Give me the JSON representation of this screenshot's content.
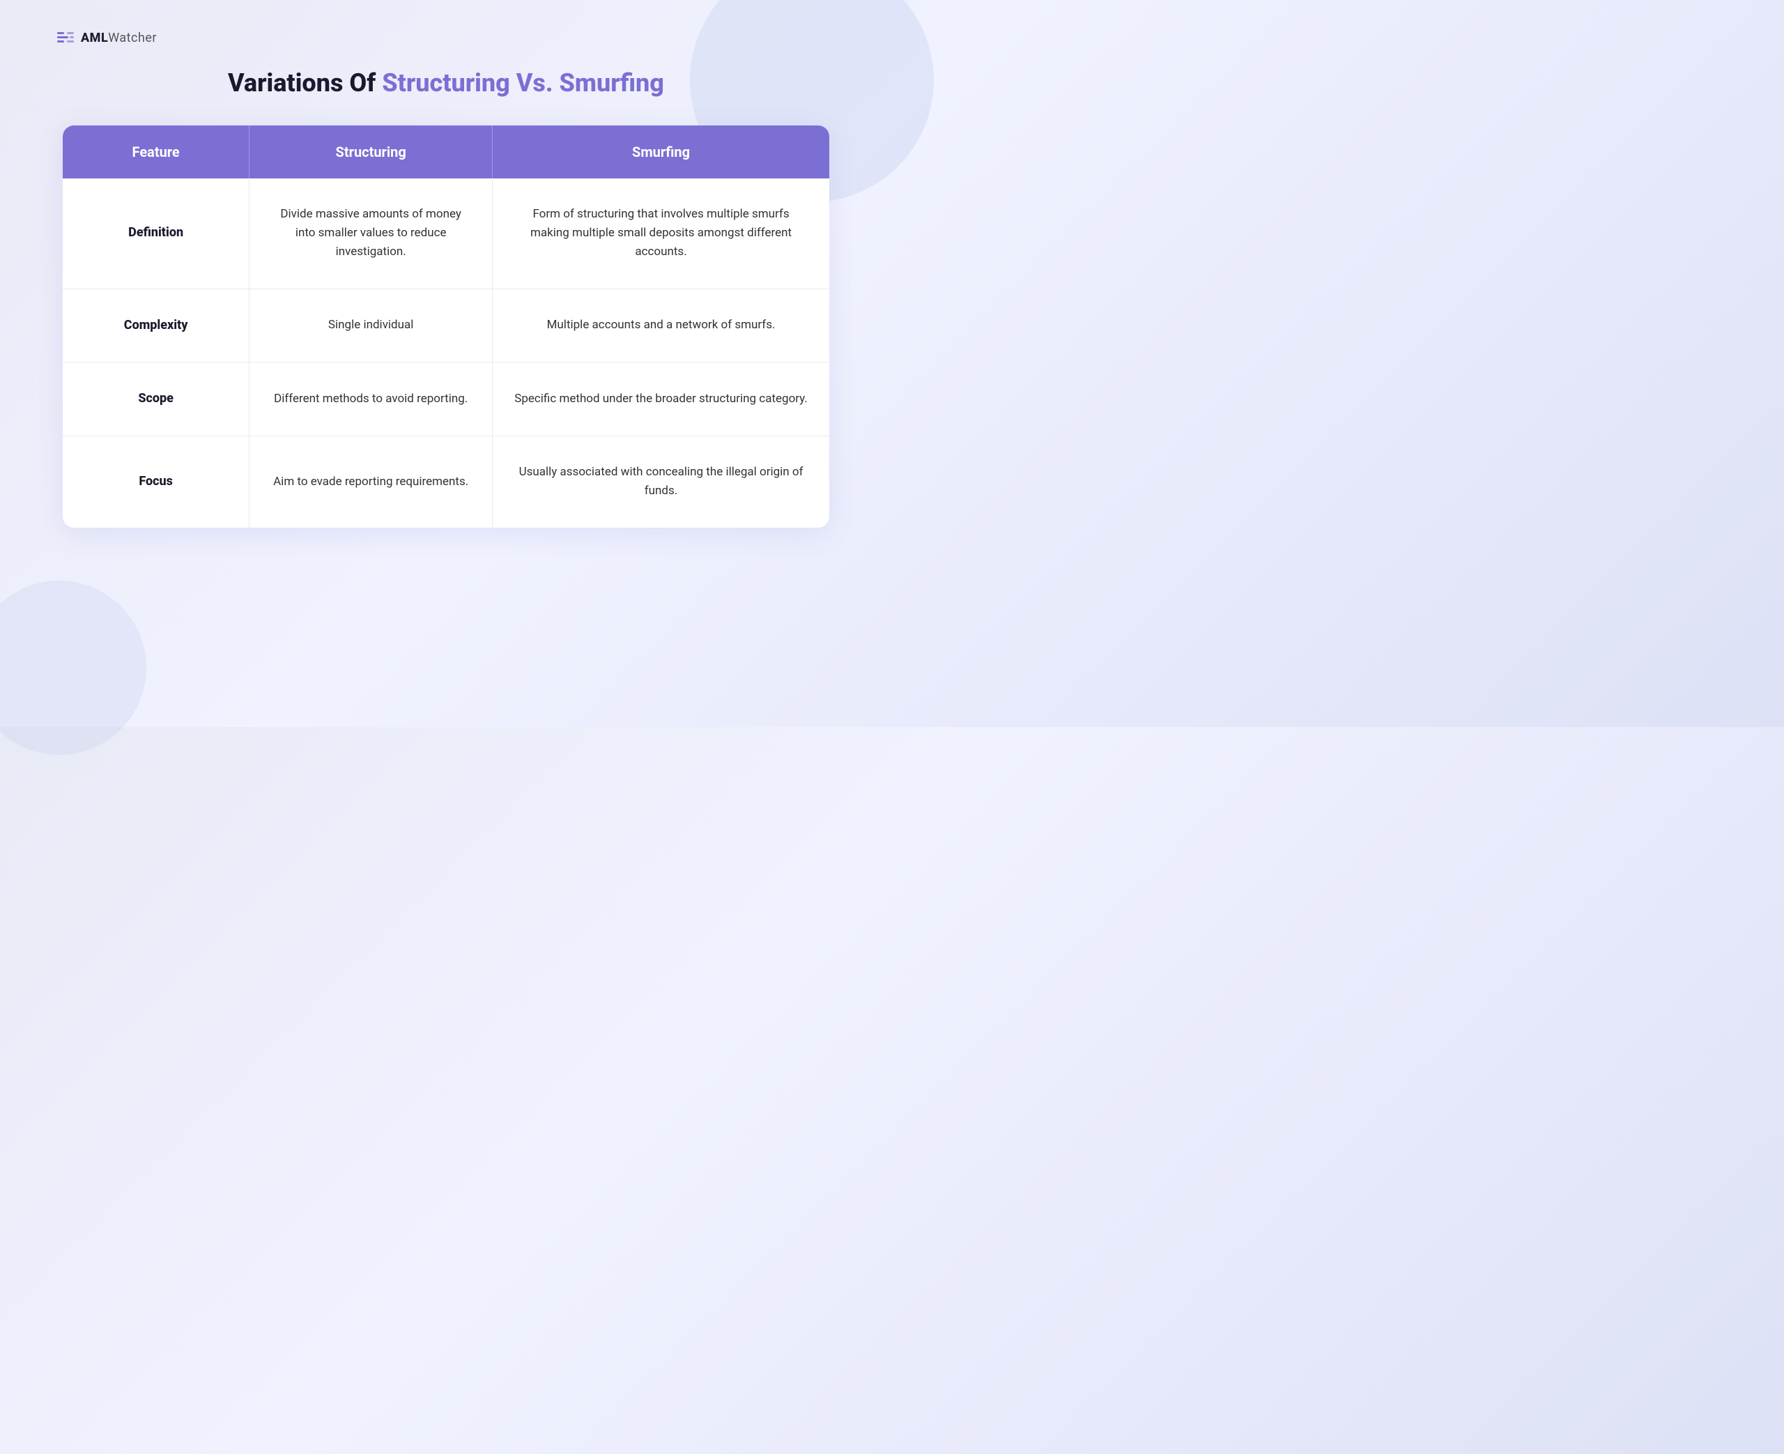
{
  "logo": {
    "text_bold": "AML",
    "text_light": "Watcher"
  },
  "title": {
    "prefix": "Variations Of ",
    "highlight": "Structuring Vs. Smurfing"
  },
  "table": {
    "headers": [
      "Feature",
      "Structuring",
      "Smurfing"
    ],
    "rows": [
      {
        "feature": "Definition",
        "structuring": "Divide massive amounts of money into smaller values to reduce investigation.",
        "smurfing": "Form of structuring that involves multiple smurfs making multiple small deposits amongst different accounts."
      },
      {
        "feature": "Complexity",
        "structuring": "Single individual",
        "smurfing": "Multiple accounts and a network of smurfs."
      },
      {
        "feature": "Scope",
        "structuring": "Different methods to avoid reporting.",
        "smurfing": "Specific method under the broader structuring category."
      },
      {
        "feature": "Focus",
        "structuring": "Aim to evade reporting requirements.",
        "smurfing": "Usually associated with concealing the illegal origin of funds."
      }
    ]
  }
}
